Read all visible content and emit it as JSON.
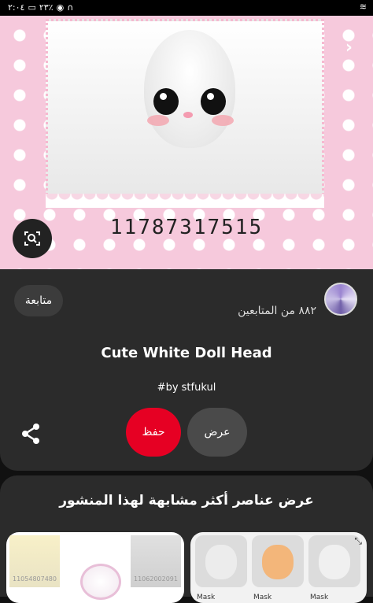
{
  "status_bar": {
    "time": "٢:٠٤",
    "battery": "٢٣٪"
  },
  "hero": {
    "asset_id": "11787317515"
  },
  "creator": {
    "followers_text": "٨٨٢ من المتابعين",
    "follow_label": "متابعة"
  },
  "pin": {
    "title": "Cute White Doll Head",
    "tag": "#by stfukul"
  },
  "actions": {
    "save_label": "حفظ",
    "view_label": "عرض"
  },
  "more": {
    "title": "عرض عناصر أكثر مشابهة لهذا المنشور",
    "card_a": {
      "left_id": "11054807480",
      "right_id": "11062002091"
    },
    "card_b": {
      "labels": [
        "Mask",
        "Mask",
        "Mask"
      ]
    }
  }
}
